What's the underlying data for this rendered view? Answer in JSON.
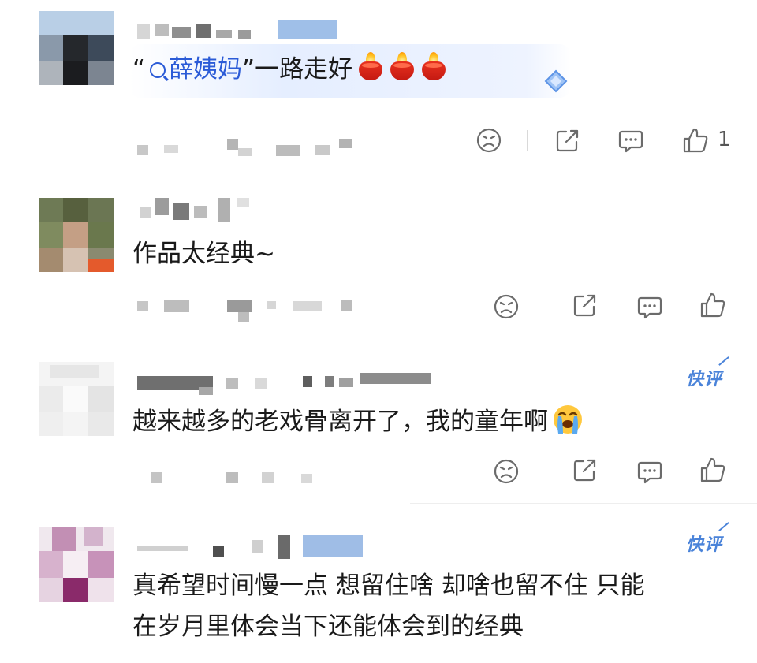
{
  "comments": [
    {
      "text_prefix": "“",
      "topic": "薛姨妈",
      "text_suffix": "”一路走好",
      "emoji": [
        "candle",
        "candle",
        "candle"
      ],
      "like_count": "1",
      "badge": ""
    },
    {
      "text": "作品太经典~",
      "like_count": "",
      "badge": ""
    },
    {
      "text": "越来越多的老戏骨离开了，我的童年啊",
      "emoji": "loudly-crying-face",
      "like_count": "",
      "badge": "快评"
    },
    {
      "text_line1": "真希望时间慢一点 想留住啥 却啥也留不住 只能",
      "text_line2": "在岁月里体会当下还能体会到的经典",
      "like_count": "",
      "badge": "快评"
    }
  ],
  "icons": {
    "dislike": "frown-face-icon",
    "share": "share-icon",
    "reply": "comment-bubble-icon",
    "like": "thumbs-up-icon"
  },
  "colors": {
    "topic_link": "#2b5bd7",
    "badge": "#4a83d9",
    "icon_stroke": "#6b6b6b"
  }
}
